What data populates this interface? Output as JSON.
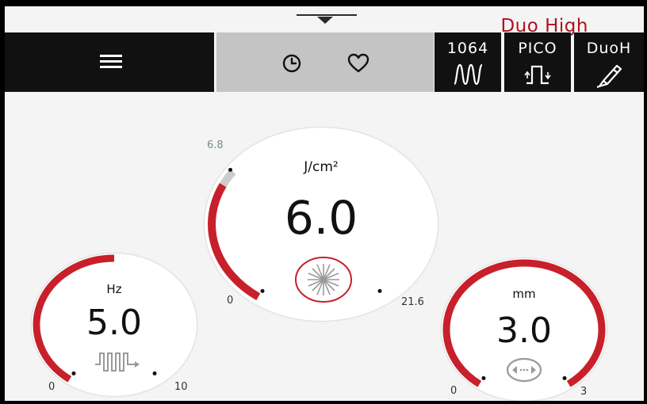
{
  "header": {
    "mode_title": "Duo High",
    "tabs": [
      {
        "label": "1064",
        "icon": "sine-wave-icon"
      },
      {
        "label": "PICO",
        "icon": "pulse-icon"
      },
      {
        "label": "DuoH",
        "icon": "handpiece-icon"
      }
    ],
    "icons": [
      "menu-icon",
      "history-icon",
      "favorite-icon"
    ]
  },
  "dials": {
    "hz": {
      "unit": "Hz",
      "value": "5.0",
      "min": "0",
      "max": "10",
      "level": 0.5,
      "icon": "pulse-train-icon"
    },
    "fluence": {
      "unit": "J/cm²",
      "value": "6.0",
      "min": "0",
      "max": "21.6",
      "limit": "6.8",
      "level": 0.28,
      "icon": "laser-spot-icon"
    },
    "mm": {
      "unit": "mm",
      "value": "3.0",
      "min": "0",
      "max": "3",
      "level": 1.0,
      "icon": "spot-size-icon"
    }
  },
  "colors": {
    "accent": "#c8202b",
    "title": "#b0121b",
    "header": "#111111",
    "center_bar": "#c4c4c4"
  }
}
